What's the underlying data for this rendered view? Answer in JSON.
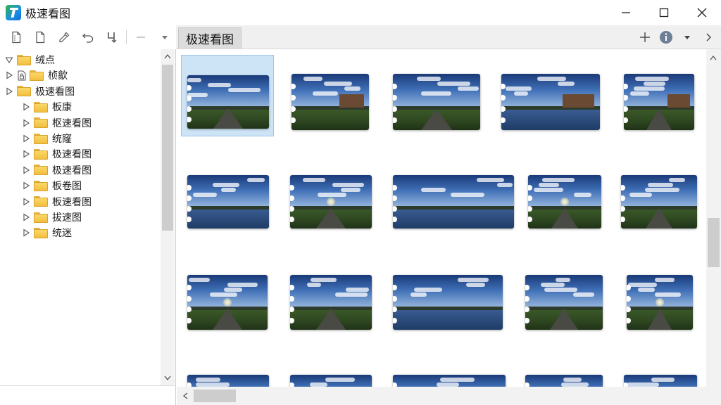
{
  "window": {
    "title": "极速看图"
  },
  "tab": {
    "label": "极速看图"
  },
  "tree": {
    "items": [
      {
        "label": "绒点",
        "level": 0,
        "expander": "open"
      },
      {
        "label": "桢歙",
        "level": 0,
        "expander": "closed",
        "doc_icon": true
      },
      {
        "label": "极速看图",
        "level": 1,
        "expander": "closed"
      },
      {
        "label": "板康",
        "level": 2,
        "expander": "closed"
      },
      {
        "label": "枢速看图",
        "level": 2,
        "expander": "closed"
      },
      {
        "label": "统窿",
        "level": 2,
        "expander": "closed"
      },
      {
        "label": "极速看图",
        "level": 2,
        "expander": "closed"
      },
      {
        "label": "极速看图",
        "level": 2,
        "expander": "closed"
      },
      {
        "label": "板卷图",
        "level": 2,
        "expander": "closed"
      },
      {
        "label": "板速看图",
        "level": 2,
        "expander": "closed"
      },
      {
        "label": "拔速图",
        "level": 2,
        "expander": "closed"
      },
      {
        "label": "统迷",
        "level": 2,
        "expander": "closed"
      }
    ]
  },
  "toolbar": {
    "icons": [
      "new-file-icon",
      "document-icon",
      "eyedropper-icon",
      "undo-icon",
      "merge-icon",
      "minus-icon",
      "dropdown-icon"
    ]
  },
  "colors": {
    "selection": "#cde4f7",
    "folder": "#f2bf3f"
  }
}
